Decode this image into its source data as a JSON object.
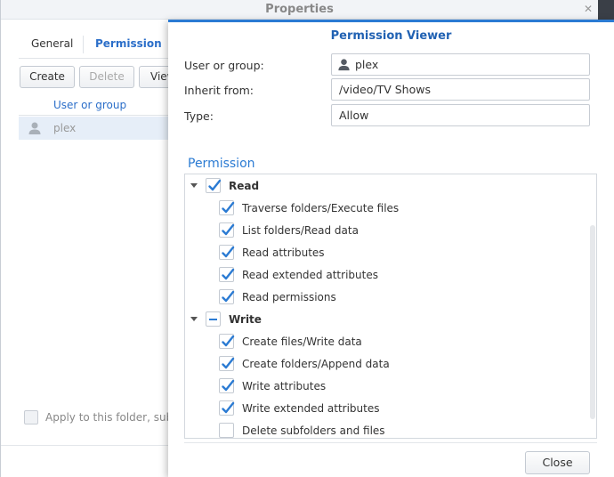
{
  "background_window": {
    "title": "Properties",
    "tabs": [
      {
        "label": "General"
      },
      {
        "label": "Permission"
      }
    ],
    "toolbar": {
      "create_label": "Create",
      "delete_label": "Delete",
      "view_label": "View"
    },
    "table": {
      "header": "User or group",
      "rows": [
        {
          "name": "plex"
        }
      ]
    },
    "footer_checkbox_label": "Apply to this folder, sub-folders and files"
  },
  "dialog": {
    "title": "Permission Viewer",
    "fields": {
      "user_label": "User or group:",
      "user_value": "plex",
      "inherit_label": "Inherit from:",
      "inherit_value": "/video/TV Shows",
      "type_label": "Type:",
      "type_value": "Allow"
    },
    "section_title": "Permission",
    "tree": {
      "read": {
        "label": "Read",
        "state": "checked",
        "children": [
          {
            "label": "Traverse folders/Execute files",
            "checked": true
          },
          {
            "label": "List folders/Read data",
            "checked": true
          },
          {
            "label": "Read attributes",
            "checked": true
          },
          {
            "label": "Read extended attributes",
            "checked": true
          },
          {
            "label": "Read permissions",
            "checked": true
          }
        ]
      },
      "write": {
        "label": "Write",
        "state": "partial",
        "children": [
          {
            "label": "Create files/Write data",
            "checked": true
          },
          {
            "label": "Create folders/Append data",
            "checked": true
          },
          {
            "label": "Write attributes",
            "checked": true
          },
          {
            "label": "Write extended attributes",
            "checked": true
          },
          {
            "label": "Delete subfolders and files",
            "checked": false
          }
        ]
      }
    },
    "close_label": "Close"
  },
  "colors": {
    "accent": "#2b7bd3",
    "title": "#2162b3"
  }
}
